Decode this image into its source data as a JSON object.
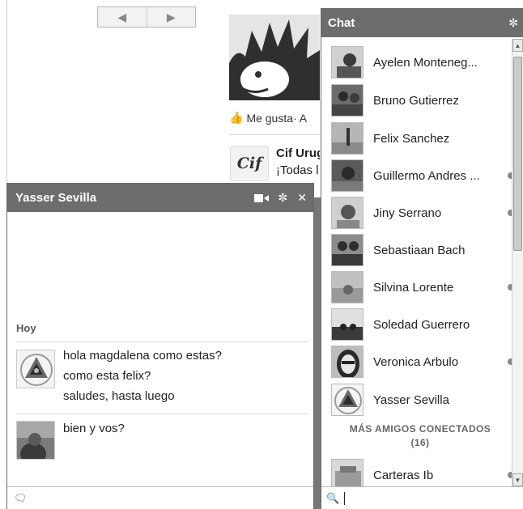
{
  "page": {
    "pager": {
      "prev_icon": "◀",
      "next_icon": "▶"
    },
    "like_row": {
      "icon": "👍",
      "text": "Me gusta· A"
    },
    "post": {
      "logo_text": "Cif",
      "name": "Cif Urug",
      "text": "¡Todas l"
    }
  },
  "conversation": {
    "title": "Yasser Sevilla",
    "actions": {
      "video": "video-call-icon",
      "gear": "✼",
      "close": "✕"
    },
    "day_label": "Hoy",
    "messages": [
      {
        "lines": [
          "hola magdalena como estas?",
          "como esta felix?",
          "saludes, hasta luego"
        ]
      },
      {
        "lines": [
          "bien y vos?"
        ]
      }
    ],
    "input_icon": "🗨"
  },
  "chat": {
    "title": "Chat",
    "gear": "✼",
    "friends": [
      {
        "name": "Ayelen Monteneg...",
        "status": "none"
      },
      {
        "name": "Bruno Gutierrez",
        "status": "none"
      },
      {
        "name": "Felix Sanchez",
        "status": "none"
      },
      {
        "name": "Guillermo Andres ...",
        "status": "idle"
      },
      {
        "name": "Jiny Serrano",
        "status": "idle"
      },
      {
        "name": "Sebastiaan Bach",
        "status": "none"
      },
      {
        "name": "Silvina Lorente",
        "status": "idle"
      },
      {
        "name": "Soledad Guerrero",
        "status": "none"
      },
      {
        "name": "Veronica Arbulo",
        "status": "idle"
      },
      {
        "name": "Yasser Sevilla",
        "status": "none"
      }
    ],
    "more_header": "MÁS AMIGOS CONECTADOS",
    "more_count": "(16)",
    "more_friends": [
      {
        "name": "Carteras Ib",
        "status": "idle"
      }
    ],
    "scroll_up": "▲",
    "scroll_down": "▼",
    "search_icon": "🔍"
  },
  "colors": {
    "header_gray": "#6d6d6d",
    "idle_dot": "#888888"
  }
}
